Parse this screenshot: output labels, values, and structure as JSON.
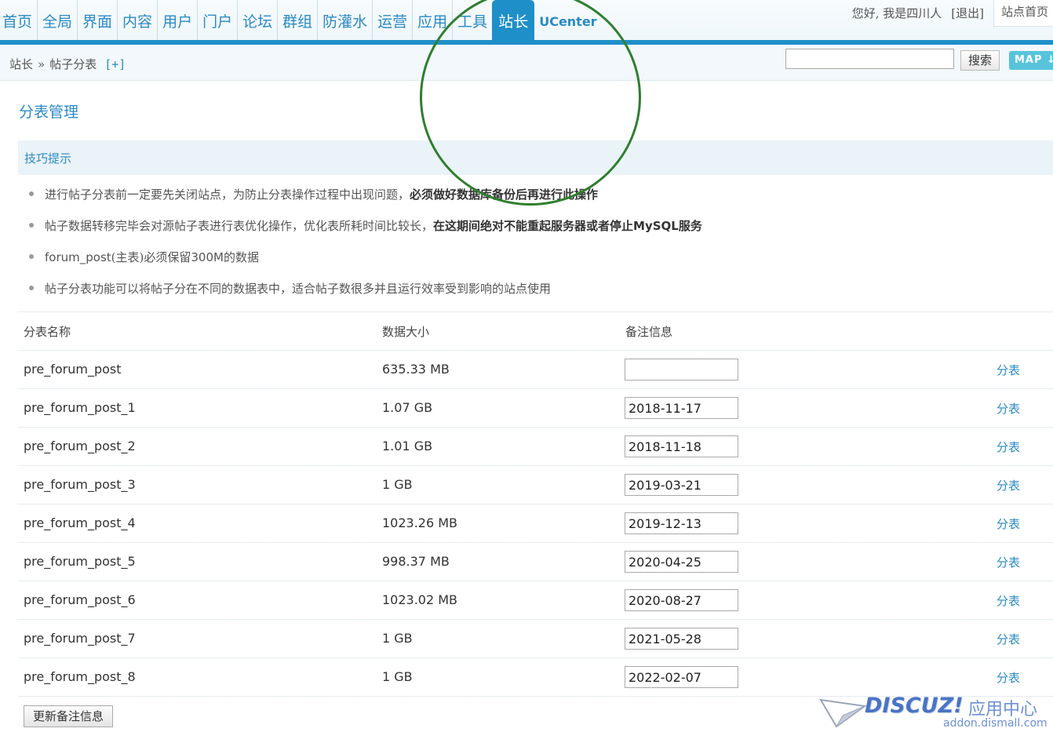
{
  "nav": {
    "items": [
      "首页",
      "全局",
      "界面",
      "内容",
      "用户",
      "门户",
      "论坛",
      "群组",
      "防灌水",
      "运营",
      "应用",
      "工具"
    ],
    "active": "站长",
    "ucenter": "UCenter"
  },
  "user": {
    "greeting": "您好, 我是四川人",
    "logout": "[退出]",
    "site_home": "站点首页"
  },
  "breadcrumb": {
    "parent": "站长",
    "arrow": "»",
    "current": "帖子分表",
    "add": "[+]"
  },
  "search": {
    "value": "",
    "button": "搜索"
  },
  "map_button": "MAP",
  "page_title": "分表管理",
  "tips": {
    "title": "技巧提示",
    "items": [
      {
        "text": "进行帖子分表前一定要先关闭站点，为防止分表操作过程中出现问题，",
        "strong": "必须做好数据库备份后再进行此操作",
        "strong_sans": "",
        "tail": ""
      },
      {
        "text": "帖子数据转移完毕会对源帖子表进行表优化操作，优化表所耗时间比较长，",
        "strong": "在这期间绝对不能重起服务器或者停止",
        "strong_sans": "MySQL",
        "tail": "服务"
      },
      {
        "prefix": "forum_post",
        "text": "(主表)必须保留",
        "num": "300M",
        "tail": "的数据"
      },
      {
        "text": "帖子分表功能可以将帖子分在不同的数据表中，适合帖子数很多并且运行效率受到影响的站点使用"
      }
    ]
  },
  "table": {
    "headers": {
      "name": "分表名称",
      "size": "数据大小",
      "note": "备注信息"
    },
    "rows": [
      {
        "name": "pre_forum_post",
        "size": "635.33 MB",
        "note": "",
        "action": "分表"
      },
      {
        "name": "pre_forum_post_1",
        "size": "1.07 GB",
        "note": "2018-11-17",
        "action": "分表"
      },
      {
        "name": "pre_forum_post_2",
        "size": "1.01 GB",
        "note": "2018-11-18",
        "action": "分表"
      },
      {
        "name": "pre_forum_post_3",
        "size": "1 GB",
        "note": "2019-03-21",
        "action": "分表"
      },
      {
        "name": "pre_forum_post_4",
        "size": "1023.26 MB",
        "note": "2019-12-13",
        "action": "分表"
      },
      {
        "name": "pre_forum_post_5",
        "size": "998.37 MB",
        "note": "2020-04-25",
        "action": "分表"
      },
      {
        "name": "pre_forum_post_6",
        "size": "1023.02 MB",
        "note": "2020-08-27",
        "action": "分表"
      },
      {
        "name": "pre_forum_post_7",
        "size": "1 GB",
        "note": "2021-05-28",
        "action": "分表"
      },
      {
        "name": "pre_forum_post_8",
        "size": "1 GB",
        "note": "2022-02-07",
        "action": "分表"
      }
    ]
  },
  "update_button": "更新备注信息",
  "watermark": {
    "logo": "DISCUZ!",
    "cn": "应用中心",
    "url": "addon.dismall.com"
  },
  "colors": {
    "accent": "#1f8fc9",
    "link": "#2b8ac4",
    "annotation": "#2f7f2f"
  }
}
